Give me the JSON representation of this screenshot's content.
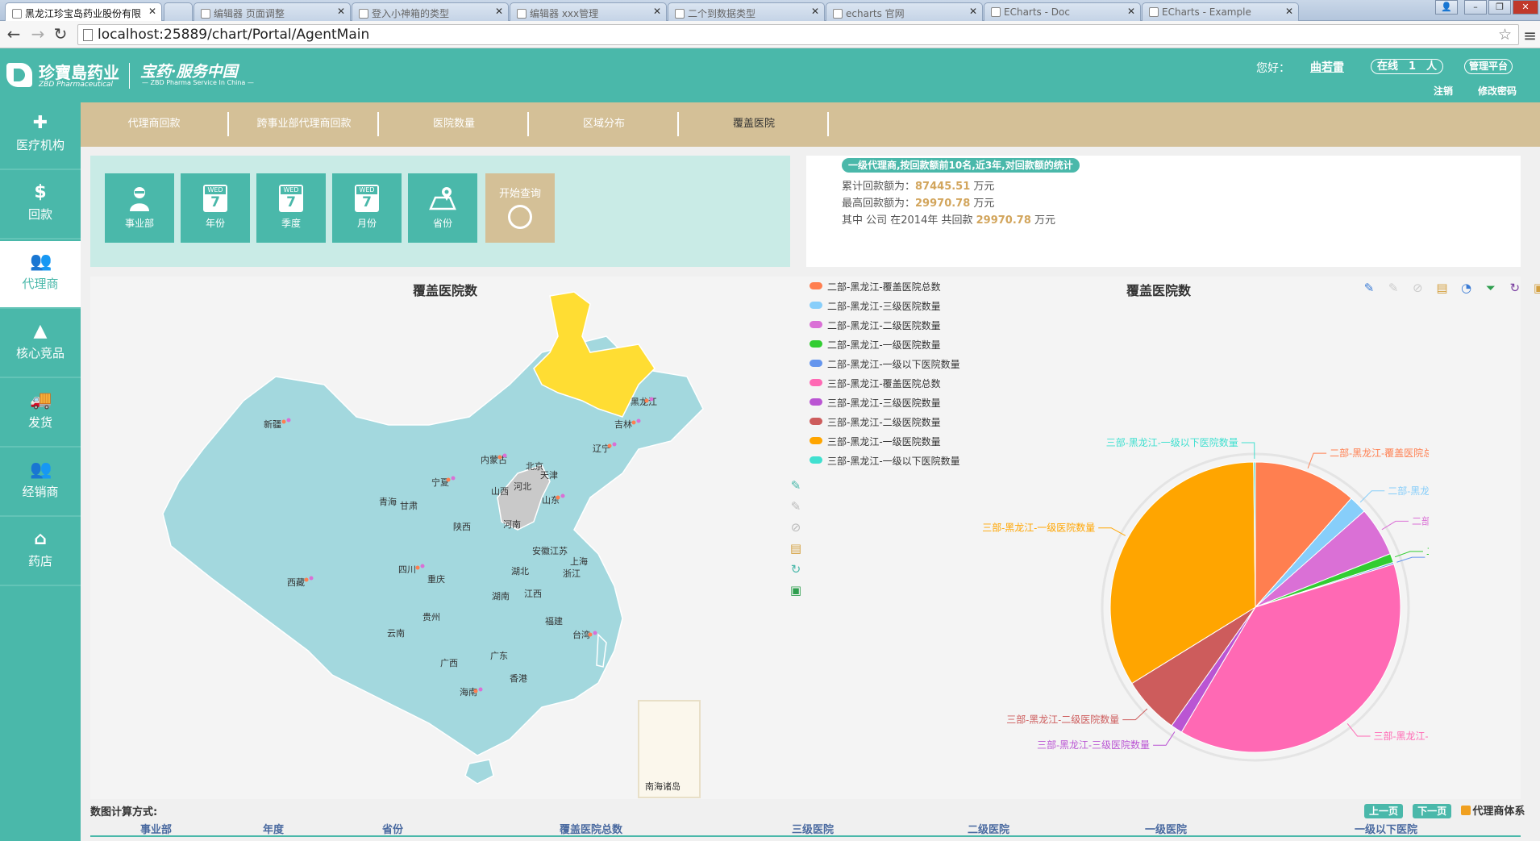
{
  "browser": {
    "tabs": [
      {
        "title": "黑龙江珍宝岛药业股份有限"
      },
      {
        "title": ""
      },
      {
        "title": "编辑器 页面调整"
      },
      {
        "title": "登入小神箱的类型"
      },
      {
        "title": "编辑器 xxx管理"
      },
      {
        "title": "二个到数据类型"
      },
      {
        "title": "echarts 官网"
      },
      {
        "title": "ECharts - Doc"
      },
      {
        "title": "ECharts - Example"
      }
    ],
    "url": "localhost:25889/chart/Portal/AgentMain"
  },
  "header": {
    "logo_cn": "珍寶島药业",
    "logo_en": "ZBD Pharmaceutical",
    "slogan": "宝药·服务中国",
    "slogan_en": "— ZBD Pharma Service In China —",
    "greeting": "您好：",
    "username": "曲若雷",
    "online_label": "在线　1　人",
    "admin_label": "管理平台",
    "logout": "注销",
    "change_password": "修改密码"
  },
  "sidebar": {
    "items": [
      {
        "label": "医疗机构",
        "icon": "medical-cross-icon"
      },
      {
        "label": "回款",
        "icon": "money-bag-icon"
      },
      {
        "label": "代理商",
        "icon": "people-icon"
      },
      {
        "label": "核心竞品",
        "icon": "triangle-warning-icon"
      },
      {
        "label": "发货",
        "icon": "truck-icon"
      },
      {
        "label": "经销商",
        "icon": "people-group-icon"
      },
      {
        "label": "药店",
        "icon": "pharmacy-house-icon"
      }
    ],
    "active": "代理商"
  },
  "topnav": {
    "items": [
      {
        "label": "代理商回款"
      },
      {
        "label": "跨事业部代理商回款"
      },
      {
        "label": "医院数量"
      },
      {
        "label": "区域分布"
      },
      {
        "label": "覆盖医院"
      }
    ],
    "active": "覆盖医院"
  },
  "query": {
    "buttons": [
      {
        "label": "事业部",
        "icon": "person-icon"
      },
      {
        "label": "年份",
        "icon": "calendar-icon",
        "weekday": "WED",
        "day": "7"
      },
      {
        "label": "季度",
        "icon": "calendar-icon",
        "weekday": "WED",
        "day": "7"
      },
      {
        "label": "月份",
        "icon": "calendar-icon",
        "weekday": "WED",
        "day": "7"
      },
      {
        "label": "省份",
        "icon": "map-pin-icon"
      }
    ],
    "go_label": "开始查询"
  },
  "summary": {
    "title": "一级代理商,按回款额前10名,近3年,对回款额的统计",
    "line1_prefix": "累计回款额为：",
    "line1_value": "87445.51",
    "line1_unit": "万元",
    "line2_prefix": "最高回款额为：",
    "line2_value": "29970.78",
    "line2_unit": "万元",
    "line3_prefix": "其中 公司 在2014年 共回款",
    "line3_value": "29970.78",
    "line3_unit": "万元"
  },
  "map": {
    "title": "覆盖医院数",
    "provinces": [
      "黑龙江",
      "吉林",
      "辽宁",
      "新疆",
      "内蒙古",
      "北京",
      "天津",
      "河北",
      "宁夏",
      "山西",
      "山东",
      "青海",
      "甘肃",
      "陕西",
      "河南",
      "安徽",
      "江苏",
      "西藏",
      "四川",
      "湖北",
      "上海",
      "浙江",
      "重庆",
      "湖南",
      "江西",
      "贵州",
      "福建",
      "台湾",
      "云南",
      "广西",
      "广东",
      "香港",
      "海南",
      "南海诸岛"
    ]
  },
  "chart_data": {
    "type": "pie",
    "title": "覆盖医院数",
    "legend": [
      {
        "name": "二部-黑龙江-覆盖医院总数",
        "color": "#ff7f50"
      },
      {
        "name": "二部-黑龙江-三级医院数量",
        "color": "#87cefa"
      },
      {
        "name": "二部-黑龙江-二级医院数量",
        "color": "#da70d6"
      },
      {
        "name": "二部-黑龙江-一级医院数量",
        "color": "#32cd32"
      },
      {
        "name": "二部-黑龙江-一级以下医院数量",
        "color": "#6495ed"
      },
      {
        "name": "三部-黑龙江-覆盖医院总数",
        "color": "#ff69b4"
      },
      {
        "name": "三部-黑龙江-三级医院数量",
        "color": "#ba55d3"
      },
      {
        "name": "三部-黑龙江-二级医院数量",
        "color": "#cd5c5c"
      },
      {
        "name": "三部-黑龙江-一级医院数量",
        "color": "#ffa500"
      },
      {
        "name": "三部-黑龙江-一级以下医院数量",
        "color": "#40e0d0"
      }
    ],
    "slices": [
      {
        "name": "二部-黑龙江-覆盖医院总数",
        "value": 11.5,
        "color": "#ff7f50"
      },
      {
        "name": "二部-黑龙江-三级医院数量",
        "value": 2.0,
        "color": "#87cefa"
      },
      {
        "name": "二部-黑龙江-二级医院数量",
        "value": 5.5,
        "color": "#da70d6"
      },
      {
        "name": "二部-黑龙江-一级医院数量",
        "value": 1.0,
        "color": "#32cd32"
      },
      {
        "name": "二部-黑龙江-一级以下医院数量",
        "value": 0.2,
        "color": "#6495ed"
      },
      {
        "name": "三部-黑龙江-覆盖医院总数",
        "value": 38.3,
        "color": "#ff69b4"
      },
      {
        "name": "三部-黑龙江-三级医院数量",
        "value": 1.3,
        "color": "#ba55d3"
      },
      {
        "name": "三部-黑龙江-二级医院数量",
        "value": 6.4,
        "color": "#cd5c5c"
      },
      {
        "name": "三部-黑龙江-一级医院数量",
        "value": 33.6,
        "color": "#ffa500"
      },
      {
        "name": "三部-黑龙江-一级以下医院数量",
        "value": 0.2,
        "color": "#40e0d0"
      }
    ]
  },
  "table": {
    "calc_label": "数图计算方式:",
    "prev_page": "上一页",
    "next_page": "下一页",
    "agent_system": "代理商体系",
    "headers": [
      "事业部",
      "年度",
      "省份",
      "覆盖医院总数",
      "三级医院",
      "二级医院",
      "一级医院",
      "一级以下医院"
    ]
  }
}
